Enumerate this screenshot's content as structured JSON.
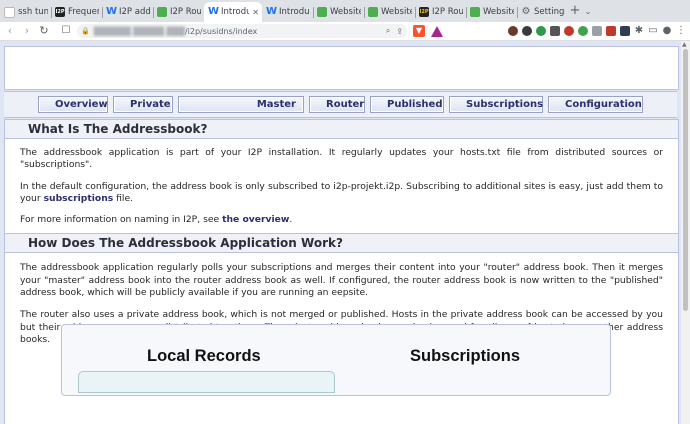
{
  "browser": {
    "tabs": [
      {
        "label": "ssh tunn",
        "favicon": "ssh",
        "active": false
      },
      {
        "label": "Frequen",
        "favicon": "i2p",
        "active": false
      },
      {
        "label": "I2P addr",
        "favicon": "w",
        "active": false
      },
      {
        "label": "I2P Rout",
        "favicon": "grid",
        "active": false
      },
      {
        "label": "Introdu",
        "favicon": "w",
        "active": true
      },
      {
        "label": "Introduct",
        "favicon": "w",
        "active": false
      },
      {
        "label": "Website",
        "favicon": "grid",
        "active": false
      },
      {
        "label": "Website",
        "favicon": "grid",
        "active": false
      },
      {
        "label": "I2P Rout",
        "favicon": "i2pg",
        "active": false
      },
      {
        "label": "Website",
        "favicon": "grid",
        "active": false
      },
      {
        "label": "Settings",
        "favicon": "gear",
        "active": false
      }
    ],
    "url": {
      "host": "██████.█████.███",
      "path": "/i2p/susidns/index"
    }
  },
  "nav": {
    "buttons": [
      "Overview",
      "Private",
      "Master",
      "Router",
      "Published",
      "Subscriptions",
      "Configuration"
    ]
  },
  "sections": [
    {
      "heading": "What Is The Addressbook?",
      "paragraphs": [
        "The addressbook application is part of your I2P installation. It regularly updates your hosts.txt file from distributed sources or \"subscriptions\".",
        "In the default configuration, the address book is only subscribed to i2p-projekt.i2p. Subscribing to additional sites is easy, just add them to your",
        "For more information on naming in I2P, see"
      ],
      "link_subscriptions": "subscriptions",
      "after_subscriptions": " file.",
      "link_overview": "the overview",
      "after_overview": "."
    },
    {
      "heading": "How Does The Addressbook Application Work?",
      "paragraphs": [
        "The addressbook application regularly polls your subscriptions and merges their content into your \"router\" address book. Then it merges your \"master\" address book into the router address book as well. If configured, the router address book is now written to the \"published\" address book, which will be publicly available if you are running an eepsite.",
        "The router also uses a private address book, which is not merged or published. Hosts in the private address book can be accessed by you but their addresses are never distributed to others. The private address book can also be used for aliases of hosts in your other address books."
      ]
    }
  ],
  "panel": {
    "local_records": "Local Records",
    "subscriptions": "Subscriptions"
  }
}
